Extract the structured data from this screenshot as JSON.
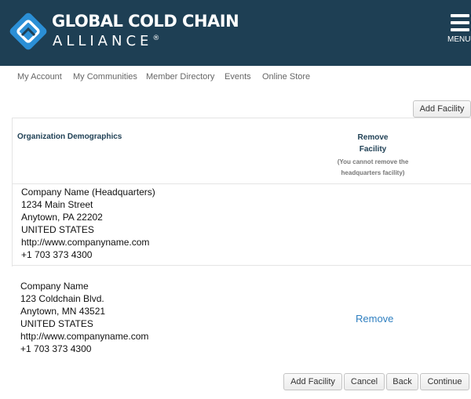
{
  "header": {
    "logo_line1": "GLOBAL COLD CHAIN",
    "logo_line2": "ALLIANCE",
    "logo_registered": "®",
    "menu_label": "MENU",
    "logo_icon": "gcca-logo-icon",
    "menu_icon": "hamburger-icon",
    "background_color": "#1e3f54"
  },
  "nav": {
    "items": [
      "My Account",
      "My Communities",
      "Member Directory",
      "Events",
      "Online Store"
    ]
  },
  "top_actions": {
    "add_facility": "Add Facility"
  },
  "table": {
    "col_org": "Organization Demographics",
    "col_remove_line1": "Remove",
    "col_remove_line2": "Facility",
    "col_remove_note_line1": "(You cannot remove the",
    "col_remove_note_line2": "headquarters facility)"
  },
  "facilities": [
    {
      "name": "Company Name (Headquarters)",
      "street": "1234 Main Street",
      "city": "Anytown, PA 22202",
      "country": "UNITED STATES",
      "website": "http://www.companyname.com",
      "phone": "+1 703 373 4300",
      "remove_label": ""
    },
    {
      "name": "Company Name",
      "street": "123 Coldchain Blvd.",
      "city": "Anytown, MN 43521",
      "country": "UNITED STATES",
      "website": "http://www.companyname.com",
      "phone": "+1 703 373 4300",
      "remove_label": "Remove"
    }
  ],
  "bottom_actions": {
    "add_facility": "Add Facility",
    "cancel": "Cancel",
    "back": "Back",
    "continue": "Continue"
  },
  "colors": {
    "link": "#2f7fc0",
    "heading": "#1e3f54"
  }
}
